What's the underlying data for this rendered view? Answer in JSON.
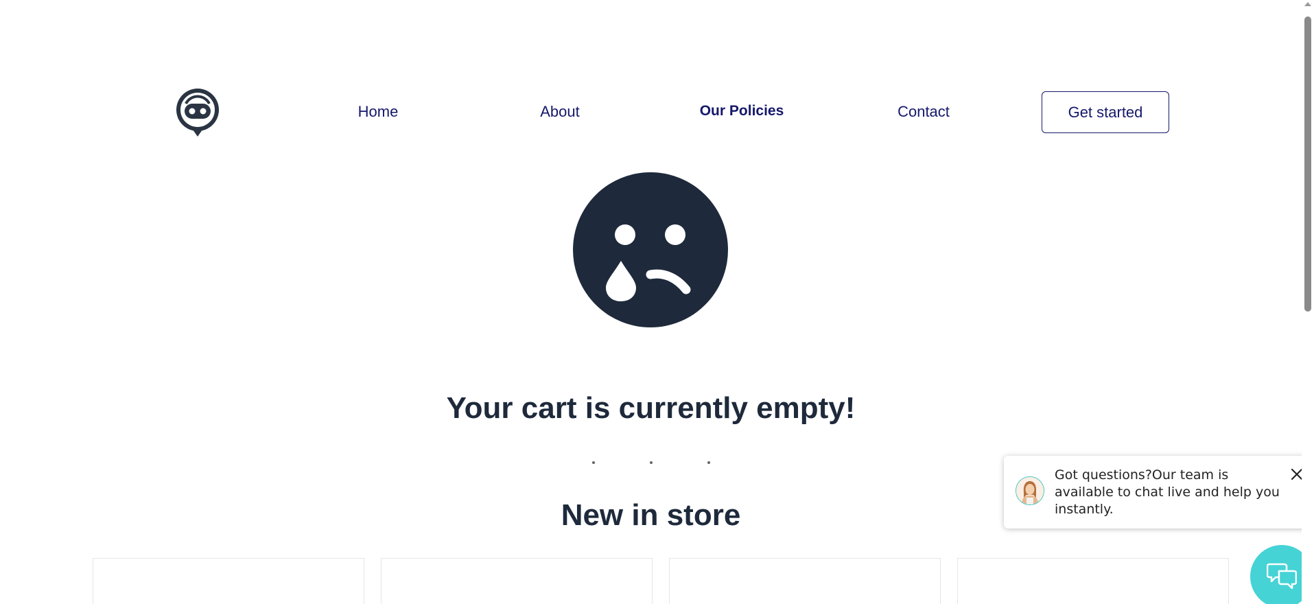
{
  "header": {
    "logo_icon": "robot-chat-bubble-icon",
    "nav": [
      {
        "label": "Home"
      },
      {
        "label": "About"
      },
      {
        "label": "Our Policies"
      },
      {
        "label": "Contact"
      }
    ],
    "cta_label": "Get started"
  },
  "cart": {
    "icon": "sad-crying-face-icon",
    "empty_message": "Your cart is currently empty!"
  },
  "store": {
    "title": "New in store"
  },
  "chat": {
    "message": "Got questions?Our team is available to chat live and help you instantly.",
    "close_icon": "close-icon",
    "fab_icon": "chat-bubbles-icon"
  },
  "colors": {
    "nav_text": "#15186b",
    "heading": "#1e2a3b",
    "chat_fab": "#45d3d6"
  }
}
